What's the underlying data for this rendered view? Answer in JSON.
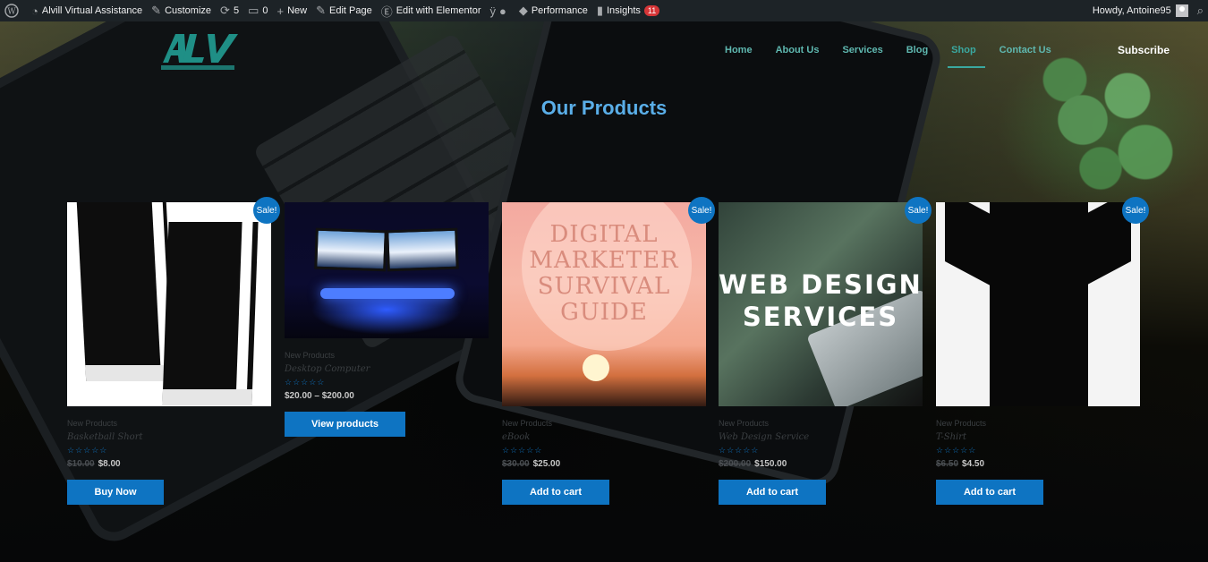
{
  "adminbar": {
    "site_name": "Alvill Virtual Assistance",
    "customize": "Customize",
    "updates_count": "5",
    "comments_count": "0",
    "new": "New",
    "edit_page": "Edit Page",
    "edit_elementor": "Edit with Elementor",
    "performance": "Performance",
    "insights": "Insights",
    "insights_badge": "11",
    "howdy": "Howdy, Antoine95"
  },
  "header": {
    "nav": [
      "Home",
      "About Us",
      "Services",
      "Blog",
      "Shop",
      "Contact Us"
    ],
    "active_nav": "Shop",
    "subscribe": "Subscribe"
  },
  "page": {
    "heading": "Our Products"
  },
  "products": [
    {
      "name": "Basketball Short",
      "category": "New Products",
      "sale_badge": "Sale!",
      "old_price": "$10.00",
      "price": "$8.00",
      "button": "Buy Now",
      "rating": 0
    },
    {
      "name": "Desktop Computer",
      "category": "New Products",
      "sale_badge": "",
      "old_price": "",
      "price": "$20.00 – $200.00",
      "button": "View products",
      "rating": 0
    },
    {
      "name": "eBook",
      "category": "New Products",
      "sale_badge": "Sale!",
      "old_price": "$30.00",
      "price": "$25.00",
      "button": "Add to cart",
      "rating": 0,
      "image_text": "DIGITAL MARKETER SURVIVAL GUIDE"
    },
    {
      "name": "Web Design Service",
      "category": "New Products",
      "sale_badge": "Sale!",
      "old_price": "$200.00",
      "price": "$150.00",
      "button": "Add to cart",
      "rating": 0,
      "image_text": "WEB DESIGN SERVICES"
    },
    {
      "name": "T-Shirt",
      "category": "New Products",
      "sale_badge": "Sale!",
      "old_price": "$6.50",
      "price": "$4.50",
      "button": "Add to cart",
      "rating": 0
    }
  ],
  "stars": "☆☆☆☆☆",
  "colors": {
    "accent": "#0e74c2",
    "nav": "#5fb8b0",
    "heading": "#5aaee8",
    "adminbar": "#1d2327"
  }
}
